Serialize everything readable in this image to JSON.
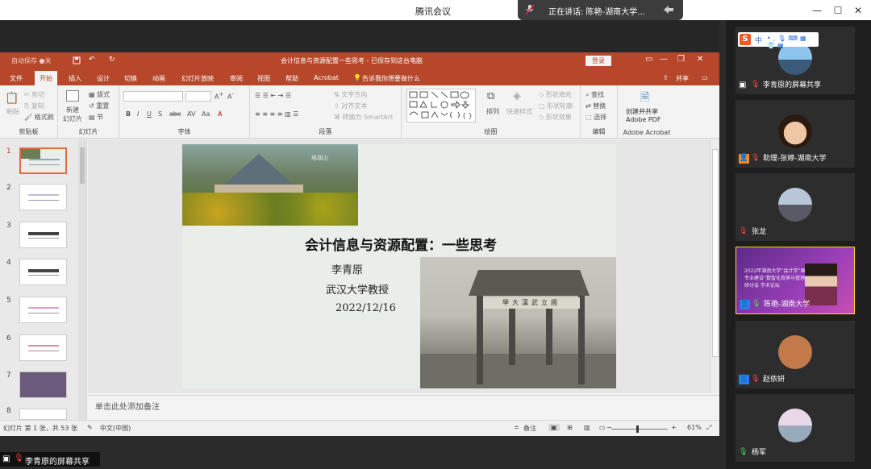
{
  "window": {
    "title": "腾讯会议",
    "speaking_label": "正在讲话: 陈艳-湖南大学..."
  },
  "ppt": {
    "quick_access": "自动保存 ●关",
    "doc_title": "会计信息与资源配置一些思考 - 已保存到这台电脑",
    "login": "登录",
    "tabs": [
      "文件",
      "开始",
      "插入",
      "设计",
      "切换",
      "动画",
      "幻灯片放映",
      "审阅",
      "视图",
      "帮助",
      "Acrobat",
      "告诉我你想要做什么"
    ],
    "share": "共享",
    "ribbon": {
      "clipboard": {
        "paste": "粘贴",
        "cut": "剪切",
        "copy": "复制",
        "format": "格式刷",
        "label": "剪贴板"
      },
      "slides": {
        "new": "新建",
        "new2": "幻灯片",
        "layout": "版式",
        "reset": "重置",
        "section": "节",
        "label": "幻灯片"
      },
      "font": {
        "label": "字体"
      },
      "paragraph": {
        "dir": "文字方向",
        "align": "对齐文本",
        "smartart": "转换为 SmartArt",
        "label": "段落"
      },
      "drawing": {
        "arrange": "排列",
        "quickstyle": "快速样式",
        "fill": "形状填充",
        "outline": "形状轮廓",
        "effect": "形状效果",
        "label": "绘图"
      },
      "edit": {
        "find": "查找",
        "replace": "替换",
        "select": "选择",
        "label": "编辑"
      },
      "acrobat": {
        "btn1": "创建并共享",
        "btn2": "Adobe PDF",
        "label": "Adobe Acrobat"
      }
    },
    "thumbnails": [
      "1",
      "2",
      "3",
      "4",
      "5",
      "6",
      "7",
      "8"
    ],
    "slide": {
      "title": "会计信息与资源配置：一些思考",
      "author": "李青原",
      "position": "武汉大学教授",
      "date": "2022/12/16",
      "gate_sign": "學大漢武立國",
      "photo_caption": "珞珈山"
    },
    "notes_placeholder": "单击此处添加备注",
    "status": {
      "slide_info": "幻灯片 第 1 张，共 53 张",
      "lang": "中文(中国)",
      "notes": "备注",
      "zoom": "61%"
    }
  },
  "share_tag": "李青原的屏幕共享",
  "participants": [
    {
      "name": "李青原的屏幕共享",
      "role": "share"
    },
    {
      "name": "助理-张婷-湖南大学",
      "role": "assistant"
    },
    {
      "name": "张龙",
      "role": "member"
    },
    {
      "name": "陈艳-湖南大学",
      "role": "speaking",
      "banner": "2022年湖南大学“会计学”国家一流本科专业建设“数智化背景与管理理论” 主题研讨会 学术论坛"
    },
    {
      "name": "赵依妍",
      "role": "member"
    },
    {
      "name": "杨军",
      "role": "member"
    }
  ],
  "sogou": {
    "label": "中"
  },
  "colors": {
    "ppt_red": "#b7472a",
    "highlight": "#ffd633",
    "sidebar": "#1e1e1e"
  }
}
